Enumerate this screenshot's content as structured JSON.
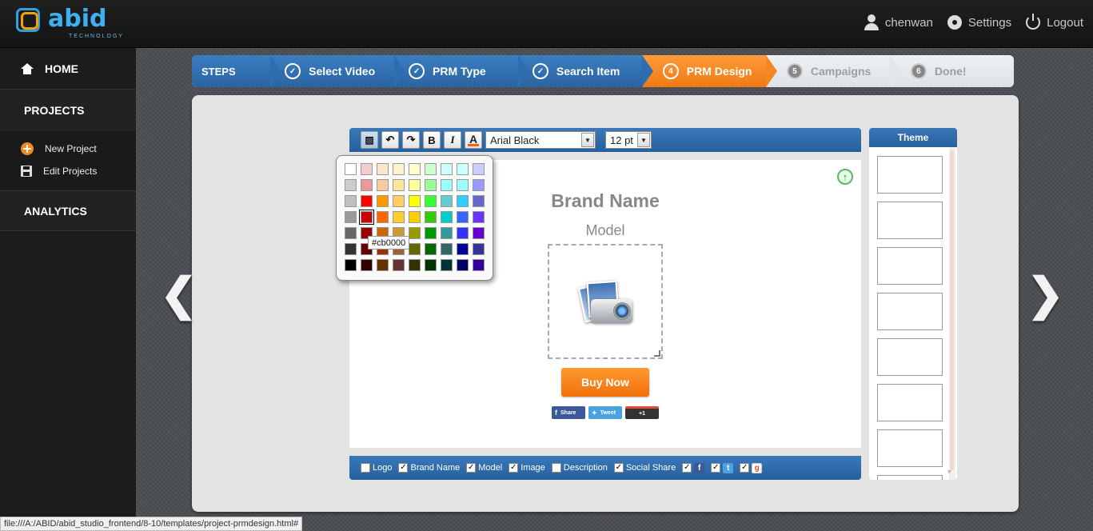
{
  "header": {
    "logo_text": "abid",
    "logo_sub": "TECHNOLOGY",
    "user_name": "chenwan",
    "settings_label": "Settings",
    "logout_label": "Logout"
  },
  "sidebar": {
    "home_label": "HOME",
    "projects_label": "PROJECTS",
    "new_project_label": "New Project",
    "edit_projects_label": "Edit Projects",
    "analytics_label": "ANALYTICS"
  },
  "steps": {
    "title": "STEPS",
    "items": [
      {
        "num": "✓",
        "label": "Select Video",
        "state": "done"
      },
      {
        "num": "✓",
        "label": "PRM Type",
        "state": "done"
      },
      {
        "num": "✓",
        "label": "Search Item",
        "state": "done"
      },
      {
        "num": "4",
        "label": "PRM Design",
        "state": "active"
      },
      {
        "num": "5",
        "label": "Campaigns",
        "state": "todo"
      },
      {
        "num": "6",
        "label": "Done!",
        "state": "todo"
      }
    ]
  },
  "nav": {
    "prev_glyph": "❮",
    "next_glyph": "❯"
  },
  "toolbar": {
    "bold_label": "B",
    "italic_label": "I",
    "font_color_label": "A",
    "font_family": "Arial Black",
    "font_size": "12 pt",
    "undo_glyph": "↶",
    "redo_glyph": "↷",
    "dropdown_glyph": "▼"
  },
  "color_picker": {
    "tooltip": "#cb0000",
    "rows": [
      [
        "#ffffff",
        "#f4cccc",
        "#fce5cd",
        "#fff2cc",
        "#ffffcc",
        "#ccffcc",
        "#ccffff",
        "#ccffff",
        "#ccccff"
      ],
      [
        "#cccccc",
        "#ea9999",
        "#f9cb9c",
        "#ffe599",
        "#ffff99",
        "#99ff99",
        "#99ffff",
        "#99ffff",
        "#9999ff"
      ],
      [
        "#c0c0c0",
        "#ff0000",
        "#ff9900",
        "#ffcc66",
        "#ffff00",
        "#33ff33",
        "#66cccc",
        "#33ccff",
        "#6666cc"
      ],
      [
        "#999999",
        "#cb0000",
        "#ff6600",
        "#ffcc33",
        "#ffcc00",
        "#33cc00",
        "#00cccc",
        "#3366ff",
        "#6633ff"
      ],
      [
        "#666666",
        "#990000",
        "#cc6600",
        "#cc9933",
        "#999900",
        "#009900",
        "#339999",
        "#3333ff",
        "#6600cc"
      ],
      [
        "#333333",
        "#660000",
        "#993300",
        "#996633",
        "#666600",
        "#006600",
        "#336666",
        "#000099",
        "#333399"
      ],
      [
        "#000000",
        "#330000",
        "#663300",
        "#663333",
        "#333300",
        "#003300",
        "#003333",
        "#000066",
        "#330099"
      ]
    ],
    "selected_color": "#cb0000"
  },
  "canvas": {
    "brand_name": "Brand Name",
    "model": "Model",
    "buy_now": "Buy Now",
    "upload_glyph": "↑",
    "share_fb": "Share",
    "share_tw": "Tweet",
    "share_gp": "+1"
  },
  "options": {
    "items": [
      {
        "label": "Logo",
        "checked": false
      },
      {
        "label": "Brand Name",
        "checked": true
      },
      {
        "label": "Model",
        "checked": true
      },
      {
        "label": "Image",
        "checked": true
      },
      {
        "label": "Description",
        "checked": false
      },
      {
        "label": "Social Share",
        "checked": true
      }
    ],
    "check_glyph": "✓",
    "social": {
      "fb": "f",
      "tw": "t",
      "gp": "g"
    }
  },
  "theme": {
    "title": "Theme",
    "thumb_count": 8
  },
  "status_bar": {
    "url": "file:///A:/ABID/abid_studio_frontend/8-10/templates/project-prmdesign.html#"
  },
  "colors": {
    "accent_blue": "#2a64a2",
    "accent_orange": "#f07a14",
    "logo_blue": "#3eb0f0"
  }
}
